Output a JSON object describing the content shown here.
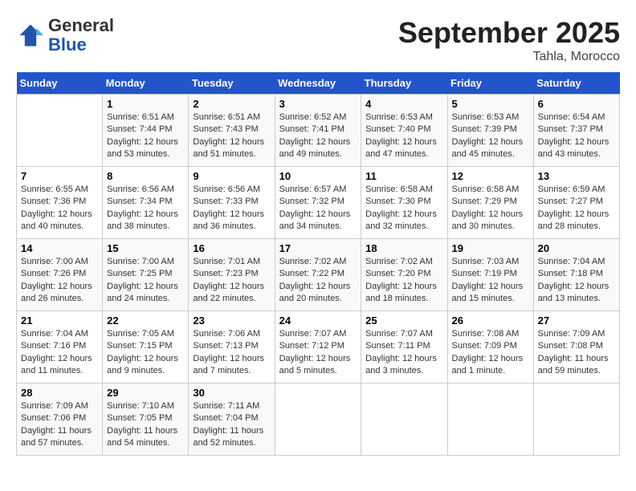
{
  "header": {
    "logo_general": "General",
    "logo_blue": "Blue",
    "month_title": "September 2025",
    "location": "Tahla, Morocco"
  },
  "days_of_week": [
    "Sunday",
    "Monday",
    "Tuesday",
    "Wednesday",
    "Thursday",
    "Friday",
    "Saturday"
  ],
  "weeks": [
    [
      {
        "day": "",
        "sunrise": "",
        "sunset": "",
        "daylight": ""
      },
      {
        "day": "1",
        "sunrise": "Sunrise: 6:51 AM",
        "sunset": "Sunset: 7:44 PM",
        "daylight": "Daylight: 12 hours and 53 minutes."
      },
      {
        "day": "2",
        "sunrise": "Sunrise: 6:51 AM",
        "sunset": "Sunset: 7:43 PM",
        "daylight": "Daylight: 12 hours and 51 minutes."
      },
      {
        "day": "3",
        "sunrise": "Sunrise: 6:52 AM",
        "sunset": "Sunset: 7:41 PM",
        "daylight": "Daylight: 12 hours and 49 minutes."
      },
      {
        "day": "4",
        "sunrise": "Sunrise: 6:53 AM",
        "sunset": "Sunset: 7:40 PM",
        "daylight": "Daylight: 12 hours and 47 minutes."
      },
      {
        "day": "5",
        "sunrise": "Sunrise: 6:53 AM",
        "sunset": "Sunset: 7:39 PM",
        "daylight": "Daylight: 12 hours and 45 minutes."
      },
      {
        "day": "6",
        "sunrise": "Sunrise: 6:54 AM",
        "sunset": "Sunset: 7:37 PM",
        "daylight": "Daylight: 12 hours and 43 minutes."
      }
    ],
    [
      {
        "day": "7",
        "sunrise": "Sunrise: 6:55 AM",
        "sunset": "Sunset: 7:36 PM",
        "daylight": "Daylight: 12 hours and 40 minutes."
      },
      {
        "day": "8",
        "sunrise": "Sunrise: 6:56 AM",
        "sunset": "Sunset: 7:34 PM",
        "daylight": "Daylight: 12 hours and 38 minutes."
      },
      {
        "day": "9",
        "sunrise": "Sunrise: 6:56 AM",
        "sunset": "Sunset: 7:33 PM",
        "daylight": "Daylight: 12 hours and 36 minutes."
      },
      {
        "day": "10",
        "sunrise": "Sunrise: 6:57 AM",
        "sunset": "Sunset: 7:32 PM",
        "daylight": "Daylight: 12 hours and 34 minutes."
      },
      {
        "day": "11",
        "sunrise": "Sunrise: 6:58 AM",
        "sunset": "Sunset: 7:30 PM",
        "daylight": "Daylight: 12 hours and 32 minutes."
      },
      {
        "day": "12",
        "sunrise": "Sunrise: 6:58 AM",
        "sunset": "Sunset: 7:29 PM",
        "daylight": "Daylight: 12 hours and 30 minutes."
      },
      {
        "day": "13",
        "sunrise": "Sunrise: 6:59 AM",
        "sunset": "Sunset: 7:27 PM",
        "daylight": "Daylight: 12 hours and 28 minutes."
      }
    ],
    [
      {
        "day": "14",
        "sunrise": "Sunrise: 7:00 AM",
        "sunset": "Sunset: 7:26 PM",
        "daylight": "Daylight: 12 hours and 26 minutes."
      },
      {
        "day": "15",
        "sunrise": "Sunrise: 7:00 AM",
        "sunset": "Sunset: 7:25 PM",
        "daylight": "Daylight: 12 hours and 24 minutes."
      },
      {
        "day": "16",
        "sunrise": "Sunrise: 7:01 AM",
        "sunset": "Sunset: 7:23 PM",
        "daylight": "Daylight: 12 hours and 22 minutes."
      },
      {
        "day": "17",
        "sunrise": "Sunrise: 7:02 AM",
        "sunset": "Sunset: 7:22 PM",
        "daylight": "Daylight: 12 hours and 20 minutes."
      },
      {
        "day": "18",
        "sunrise": "Sunrise: 7:02 AM",
        "sunset": "Sunset: 7:20 PM",
        "daylight": "Daylight: 12 hours and 18 minutes."
      },
      {
        "day": "19",
        "sunrise": "Sunrise: 7:03 AM",
        "sunset": "Sunset: 7:19 PM",
        "daylight": "Daylight: 12 hours and 15 minutes."
      },
      {
        "day": "20",
        "sunrise": "Sunrise: 7:04 AM",
        "sunset": "Sunset: 7:18 PM",
        "daylight": "Daylight: 12 hours and 13 minutes."
      }
    ],
    [
      {
        "day": "21",
        "sunrise": "Sunrise: 7:04 AM",
        "sunset": "Sunset: 7:16 PM",
        "daylight": "Daylight: 12 hours and 11 minutes."
      },
      {
        "day": "22",
        "sunrise": "Sunrise: 7:05 AM",
        "sunset": "Sunset: 7:15 PM",
        "daylight": "Daylight: 12 hours and 9 minutes."
      },
      {
        "day": "23",
        "sunrise": "Sunrise: 7:06 AM",
        "sunset": "Sunset: 7:13 PM",
        "daylight": "Daylight: 12 hours and 7 minutes."
      },
      {
        "day": "24",
        "sunrise": "Sunrise: 7:07 AM",
        "sunset": "Sunset: 7:12 PM",
        "daylight": "Daylight: 12 hours and 5 minutes."
      },
      {
        "day": "25",
        "sunrise": "Sunrise: 7:07 AM",
        "sunset": "Sunset: 7:11 PM",
        "daylight": "Daylight: 12 hours and 3 minutes."
      },
      {
        "day": "26",
        "sunrise": "Sunrise: 7:08 AM",
        "sunset": "Sunset: 7:09 PM",
        "daylight": "Daylight: 12 hours and 1 minute."
      },
      {
        "day": "27",
        "sunrise": "Sunrise: 7:09 AM",
        "sunset": "Sunset: 7:08 PM",
        "daylight": "Daylight: 11 hours and 59 minutes."
      }
    ],
    [
      {
        "day": "28",
        "sunrise": "Sunrise: 7:09 AM",
        "sunset": "Sunset: 7:06 PM",
        "daylight": "Daylight: 11 hours and 57 minutes."
      },
      {
        "day": "29",
        "sunrise": "Sunrise: 7:10 AM",
        "sunset": "Sunset: 7:05 PM",
        "daylight": "Daylight: 11 hours and 54 minutes."
      },
      {
        "day": "30",
        "sunrise": "Sunrise: 7:11 AM",
        "sunset": "Sunset: 7:04 PM",
        "daylight": "Daylight: 11 hours and 52 minutes."
      },
      {
        "day": "",
        "sunrise": "",
        "sunset": "",
        "daylight": ""
      },
      {
        "day": "",
        "sunrise": "",
        "sunset": "",
        "daylight": ""
      },
      {
        "day": "",
        "sunrise": "",
        "sunset": "",
        "daylight": ""
      },
      {
        "day": "",
        "sunrise": "",
        "sunset": "",
        "daylight": ""
      }
    ]
  ]
}
